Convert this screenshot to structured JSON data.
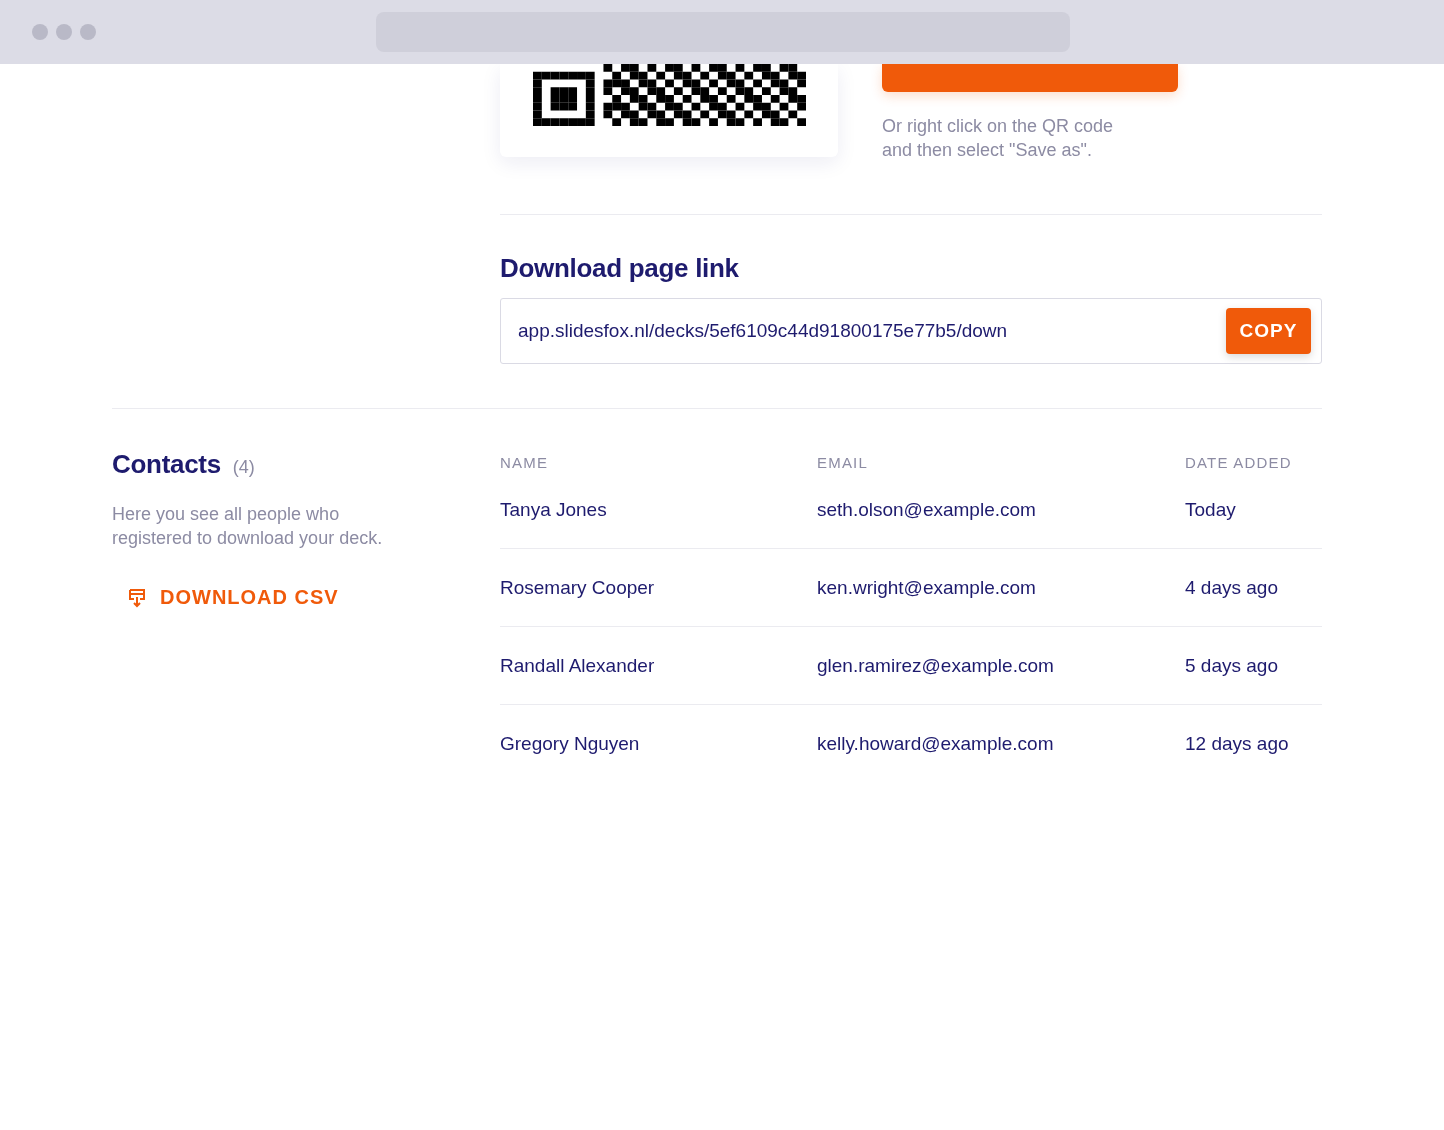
{
  "qr_section": {
    "hint": "Or right click on the QR code\nand then select \"Save as\"."
  },
  "download_link": {
    "title": "Download page link",
    "value": "app.slidesfox.nl/decks/5ef6109c44d91800175e77b5/down",
    "button": "COPY"
  },
  "contacts": {
    "title": "Contacts",
    "count": "(4)",
    "description": "Here you see all people who\nregistered to download your deck.",
    "download_button": "DOWNLOAD CSV",
    "table": {
      "columns": [
        "NAME",
        "EMAIL",
        "DATE ADDED"
      ],
      "rows": [
        [
          "Tanya Jones",
          "seth.olson@example.com",
          "Today"
        ],
        [
          "Rosemary Cooper",
          "ken.wright@example.com",
          "4 days ago"
        ],
        [
          "Randall Alexander",
          "glen.ramirez@example.com",
          "5 days ago"
        ],
        [
          "Gregory Nguyen",
          "kelly.howard@example.com",
          "12 days ago"
        ]
      ]
    }
  }
}
